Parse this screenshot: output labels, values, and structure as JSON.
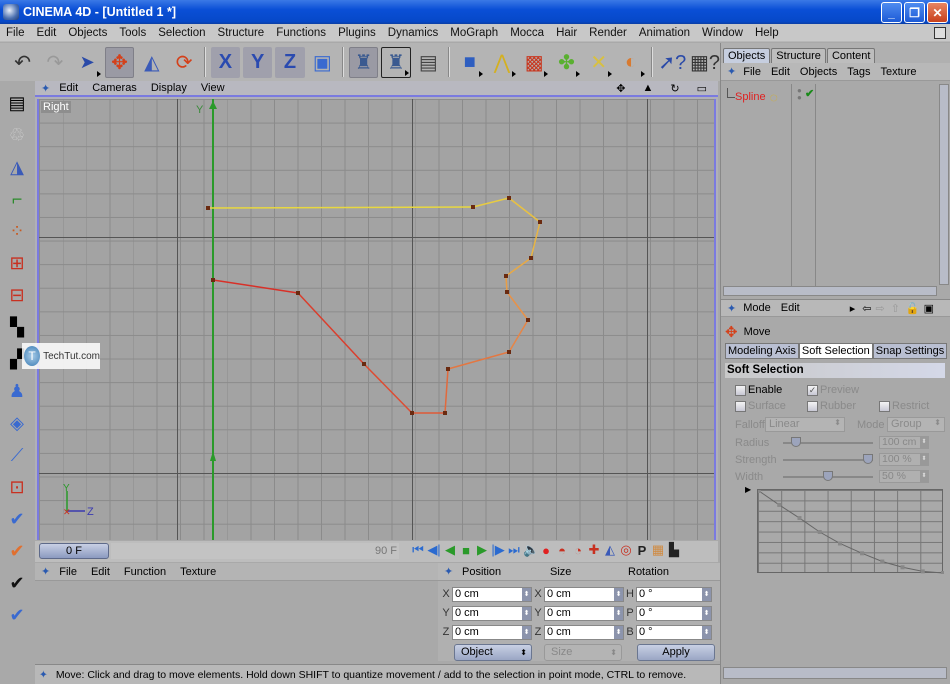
{
  "window": {
    "title": "CINEMA 4D - [Untitled 1 *]",
    "controls": [
      "minimize",
      "restore",
      "close"
    ]
  },
  "menubar": {
    "items": [
      "File",
      "Edit",
      "Objects",
      "Tools",
      "Selection",
      "Structure",
      "Functions",
      "Plugins",
      "Dynamics",
      "MoGraph",
      "Mocca",
      "Hair",
      "Render",
      "Animation",
      "Window",
      "Help"
    ]
  },
  "toolbar": {
    "icons": [
      "undo-icon",
      "redo-icon",
      "live-selection-icon",
      "move-icon",
      "scale-icon",
      "rotate-icon",
      "x-axis-lock-icon",
      "y-axis-lock-icon",
      "z-axis-lock-icon",
      "coordinate-system-icon",
      "render-view-icon",
      "render-region-icon",
      "render-picture-viewer-icon",
      "cube-primitive-icon",
      "spline-tools-icon",
      "nurbs-icon",
      "array-icon",
      "deformer-icon",
      "scene-object-icon",
      "context-help-icon",
      "command-help-icon"
    ],
    "active": "move-icon",
    "axis_labels": {
      "x": "X",
      "y": "Y",
      "z": "Z",
      "h": "H",
      "p": "P",
      "b": "B"
    }
  },
  "left_tools": [
    "layout-icon",
    "model-tool-icon",
    "object-tool-icon",
    "object-axis-tool-icon",
    "points-tool-icon",
    "edges-tool-icon",
    "polygons-tool-icon",
    "texture-tool-icon",
    "texture-axis-tool-icon",
    "sculpt-tool-icon",
    "bricks-tool-icon",
    "ik-tool-icon",
    "tweak-mode-icon",
    "snap-enable-icon",
    "workplane-icon",
    "shading-icon",
    "particles-icon"
  ],
  "viewport": {
    "menu": [
      "Edit",
      "Cameras",
      "Display",
      "View"
    ],
    "view_name": "Right",
    "nav_icons": [
      "pan-icon",
      "zoom-icon",
      "rotate-view-icon",
      "maximize-icon"
    ],
    "axis_y_label": "Y",
    "gizmo": {
      "y": "Y",
      "z": "Z"
    },
    "spline": {
      "name": "Spline",
      "points": [
        [
          208,
          208
        ],
        [
          473,
          207
        ],
        [
          509,
          198
        ],
        [
          540,
          222
        ],
        [
          531,
          258
        ],
        [
          506,
          276
        ],
        [
          507,
          292
        ],
        [
          528,
          320
        ],
        [
          509,
          352
        ],
        [
          448,
          369
        ],
        [
          445,
          413
        ],
        [
          412,
          413
        ],
        [
          364,
          364
        ],
        [
          298,
          293
        ],
        [
          213,
          280
        ]
      ]
    }
  },
  "watermark": {
    "text": "TechTut.com",
    "logo": "T"
  },
  "timeline": {
    "current_frame": "0 F",
    "end_frame": "90 F",
    "controls": [
      "go-to-start-icon",
      "previous-key-icon",
      "play-backwards-icon",
      "stop-icon",
      "play-icon",
      "next-key-icon",
      "go-to-end-icon",
      "sound-icon",
      "record-icon",
      "autokey-icon",
      "keyframe-selection-icon",
      "position-key-icon",
      "scale-key-icon",
      "rotation-key-icon",
      "parameter-key-icon",
      "pla-key-icon",
      "interpolation-icon"
    ],
    "param_key_label": "P"
  },
  "materials": {
    "menu": [
      "File",
      "Edit",
      "Function",
      "Texture"
    ]
  },
  "coordinates": {
    "headers": [
      "Position",
      "Size",
      "Rotation"
    ],
    "position": [
      {
        "axis": "X",
        "value": "0 cm"
      },
      {
        "axis": "Y",
        "value": "0 cm"
      },
      {
        "axis": "Z",
        "value": "0 cm"
      }
    ],
    "size": [
      {
        "axis": "X",
        "value": "0 cm"
      },
      {
        "axis": "Y",
        "value": "0 cm"
      },
      {
        "axis": "Z",
        "value": "0 cm"
      }
    ],
    "rotation": [
      {
        "axis": "H",
        "value": "0 °"
      },
      {
        "axis": "P",
        "value": "0 °"
      },
      {
        "axis": "B",
        "value": "0 °"
      }
    ],
    "mode": "Object",
    "size_mode": "Size",
    "apply": "Apply"
  },
  "status": {
    "text": "Move: Click and drag to move elements. Hold down SHIFT to quantize movement / add to the selection in point mode, CTRL to remove."
  },
  "object_manager": {
    "tabs": [
      {
        "label": "Objects",
        "active": true
      },
      {
        "label": "Structure",
        "active": false
      },
      {
        "label": "Content",
        "active": false
      }
    ],
    "menu": [
      "File",
      "Edit",
      "Objects",
      "Tags",
      "Texture"
    ],
    "objects": [
      {
        "name": "Spline",
        "color": "#e02020",
        "visible": true,
        "enabled": true
      }
    ]
  },
  "attributes": {
    "menu": [
      "Mode",
      "Edit"
    ],
    "tool_name": "Move",
    "tabs": [
      {
        "label": "Modeling Axis",
        "active": false
      },
      {
        "label": "Soft Selection",
        "active": true
      },
      {
        "label": "Snap Settings",
        "active": false
      }
    ],
    "section": "Soft Selection",
    "enable": {
      "label": "Enable",
      "checked": false
    },
    "preview": {
      "label": "Preview",
      "checked": true
    },
    "surface": {
      "label": "Surface",
      "checked": false
    },
    "rubber": {
      "label": "Rubber",
      "checked": false
    },
    "restrict": {
      "label": "Restrict",
      "checked": false
    },
    "falloff": {
      "label": "Falloff",
      "value": "Linear"
    },
    "mode": {
      "label": "Mode",
      "value": "Group"
    },
    "radius": {
      "label": "Radius",
      "value": "100 cm",
      "slider": 0.1
    },
    "strength": {
      "label": "Strength",
      "value": "100 %",
      "slider": 1.0
    },
    "width": {
      "label": "Width",
      "value": "50 %",
      "slider": 0.5
    },
    "curve_points": [
      [
        0,
        1.0
      ],
      [
        0.11,
        0.83
      ],
      [
        0.22,
        0.67
      ],
      [
        0.33,
        0.5
      ],
      [
        0.44,
        0.36
      ],
      [
        0.56,
        0.24
      ],
      [
        0.67,
        0.14
      ],
      [
        0.78,
        0.07
      ],
      [
        0.89,
        0.02
      ],
      [
        1.0,
        0.0
      ]
    ]
  }
}
